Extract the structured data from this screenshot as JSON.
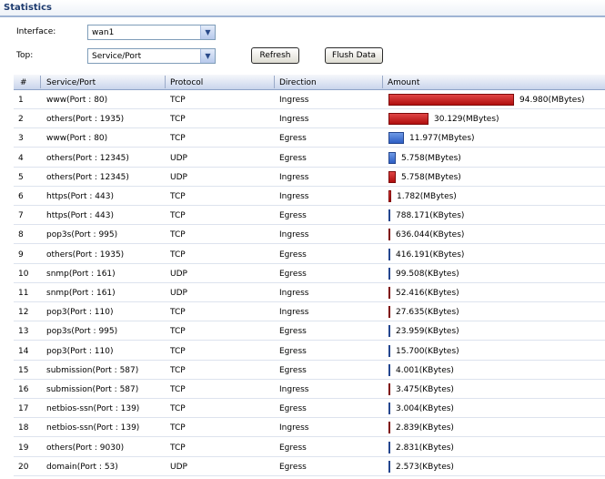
{
  "title": "Statistics",
  "interface": {
    "label": "Interface:",
    "value": "wan1"
  },
  "top": {
    "label": "Top:",
    "value": "Service/Port"
  },
  "buttons": {
    "refresh": "Refresh",
    "flush": "Flush Data"
  },
  "columns": {
    "num": "#",
    "service": "Service/Port",
    "protocol": "Protocol",
    "direction": "Direction",
    "amount": "Amount"
  },
  "colors": {
    "ingress": "#c41616",
    "egress": "#3a6acd"
  },
  "rows": [
    {
      "num": "1",
      "service": "www(Port : 80)",
      "protocol": "TCP",
      "direction": "Ingress",
      "amount": "94.980(MBytes)",
      "share": 1.0
    },
    {
      "num": "2",
      "service": "others(Port : 1935)",
      "protocol": "TCP",
      "direction": "Ingress",
      "amount": "30.129(MBytes)",
      "share": 0.317
    },
    {
      "num": "3",
      "service": "www(Port : 80)",
      "protocol": "TCP",
      "direction": "Egress",
      "amount": "11.977(MBytes)",
      "share": 0.126
    },
    {
      "num": "4",
      "service": "others(Port : 12345)",
      "protocol": "UDP",
      "direction": "Egress",
      "amount": "5.758(MBytes)",
      "share": 0.061
    },
    {
      "num": "5",
      "service": "others(Port : 12345)",
      "protocol": "UDP",
      "direction": "Ingress",
      "amount": "5.758(MBytes)",
      "share": 0.061
    },
    {
      "num": "6",
      "service": "https(Port : 443)",
      "protocol": "TCP",
      "direction": "Ingress",
      "amount": "1.782(MBytes)",
      "share": 0.019
    },
    {
      "num": "7",
      "service": "https(Port : 443)",
      "protocol": "TCP",
      "direction": "Egress",
      "amount": "788.171(KBytes)",
      "share": 0.008
    },
    {
      "num": "8",
      "service": "pop3s(Port : 995)",
      "protocol": "TCP",
      "direction": "Ingress",
      "amount": "636.044(KBytes)",
      "share": 0.0065
    },
    {
      "num": "9",
      "service": "others(Port : 1935)",
      "protocol": "TCP",
      "direction": "Egress",
      "amount": "416.191(KBytes)",
      "share": 0.0043
    },
    {
      "num": "10",
      "service": "snmp(Port : 161)",
      "protocol": "UDP",
      "direction": "Egress",
      "amount": "99.508(KBytes)",
      "share": 0.001
    },
    {
      "num": "11",
      "service": "snmp(Port : 161)",
      "protocol": "UDP",
      "direction": "Ingress",
      "amount": "52.416(KBytes)",
      "share": 0.0005
    },
    {
      "num": "12",
      "service": "pop3(Port : 110)",
      "protocol": "TCP",
      "direction": "Ingress",
      "amount": "27.635(KBytes)",
      "share": 0.0003
    },
    {
      "num": "13",
      "service": "pop3s(Port : 995)",
      "protocol": "TCP",
      "direction": "Egress",
      "amount": "23.959(KBytes)",
      "share": 0.0002
    },
    {
      "num": "14",
      "service": "pop3(Port : 110)",
      "protocol": "TCP",
      "direction": "Egress",
      "amount": "15.700(KBytes)",
      "share": 0.0002
    },
    {
      "num": "15",
      "service": "submission(Port : 587)",
      "protocol": "TCP",
      "direction": "Egress",
      "amount": "4.001(KBytes)",
      "share": 4e-05
    },
    {
      "num": "16",
      "service": "submission(Port : 587)",
      "protocol": "TCP",
      "direction": "Ingress",
      "amount": "3.475(KBytes)",
      "share": 4e-05
    },
    {
      "num": "17",
      "service": "netbios-ssn(Port : 139)",
      "protocol": "TCP",
      "direction": "Egress",
      "amount": "3.004(KBytes)",
      "share": 3e-05
    },
    {
      "num": "18",
      "service": "netbios-ssn(Port : 139)",
      "protocol": "TCP",
      "direction": "Ingress",
      "amount": "2.839(KBytes)",
      "share": 3e-05
    },
    {
      "num": "19",
      "service": "others(Port : 9030)",
      "protocol": "TCP",
      "direction": "Egress",
      "amount": "2.831(KBytes)",
      "share": 3e-05
    },
    {
      "num": "20",
      "service": "domain(Port : 53)",
      "protocol": "UDP",
      "direction": "Egress",
      "amount": "2.573(KBytes)",
      "share": 3e-05
    }
  ]
}
